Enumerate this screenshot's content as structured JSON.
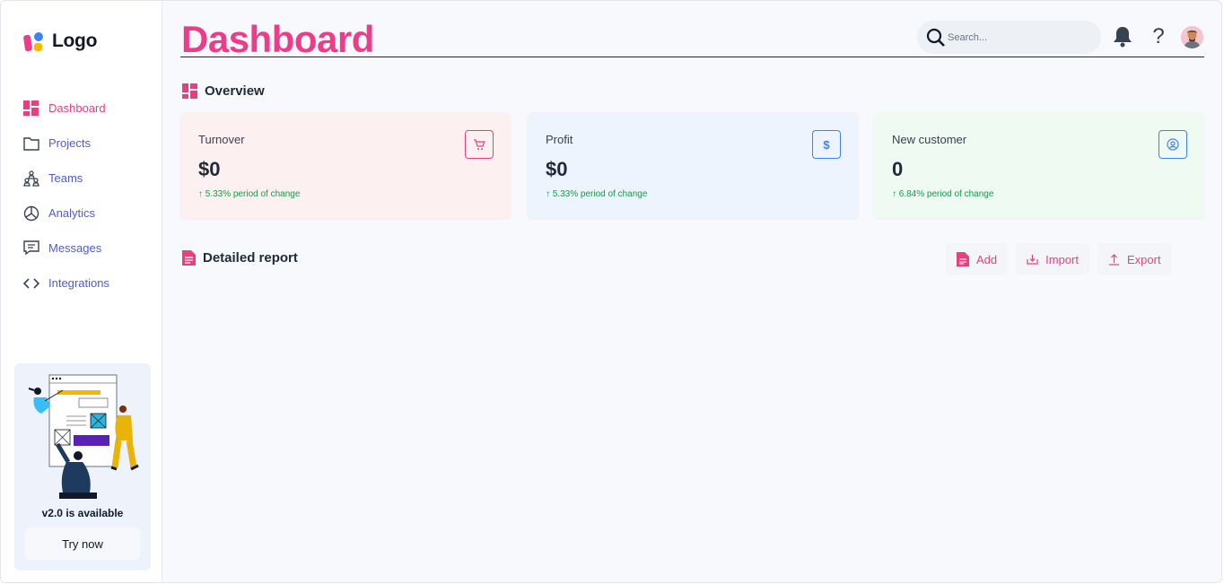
{
  "sidebar": {
    "logo_text": "Logo",
    "items": [
      {
        "label": "Dashboard",
        "icon": "dashboard-grid-icon"
      },
      {
        "label": "Projects",
        "icon": "folder-icon"
      },
      {
        "label": "Teams",
        "icon": "teams-icon"
      },
      {
        "label": "Analytics",
        "icon": "pie-chart-icon"
      },
      {
        "label": "Messages",
        "icon": "message-icon"
      },
      {
        "label": "Integrations",
        "icon": "code-icon"
      }
    ],
    "active_item": "Dashboard",
    "promo": {
      "text": "v2.0 is available",
      "button": "Try now"
    }
  },
  "header": {
    "title": "Dashboard",
    "search_placeholder": "Search...",
    "icons": [
      "search-icon",
      "bell-icon",
      "help-icon",
      "avatar"
    ]
  },
  "overview": {
    "heading": "Overview",
    "cards": [
      {
        "label": "Turnover",
        "value": "$0",
        "change": "↑ 5.33% period of change",
        "icon": "cart-icon",
        "color": "#e8407f",
        "bg": "#fdf0f0"
      },
      {
        "label": "Profit",
        "value": "$0",
        "change": "↑ 5.33% period of change",
        "icon": "dollar-icon",
        "color": "#3b82f6",
        "bg": "#eef4fd"
      },
      {
        "label": "New customer",
        "value": "0",
        "change": "↑ 6.84% period of change",
        "icon": "user-circle-icon",
        "color": "#3b82f6",
        "bg": "#eefaf2"
      }
    ]
  },
  "report": {
    "heading": "Detailed report",
    "actions": [
      {
        "label": "Add",
        "icon": "document-icon"
      },
      {
        "label": "Import",
        "icon": "import-icon"
      },
      {
        "label": "Export",
        "icon": "export-icon"
      }
    ]
  },
  "colors": {
    "accent": "#e8407f",
    "nav": "#4f5bd5",
    "positive": "#159a4a"
  }
}
